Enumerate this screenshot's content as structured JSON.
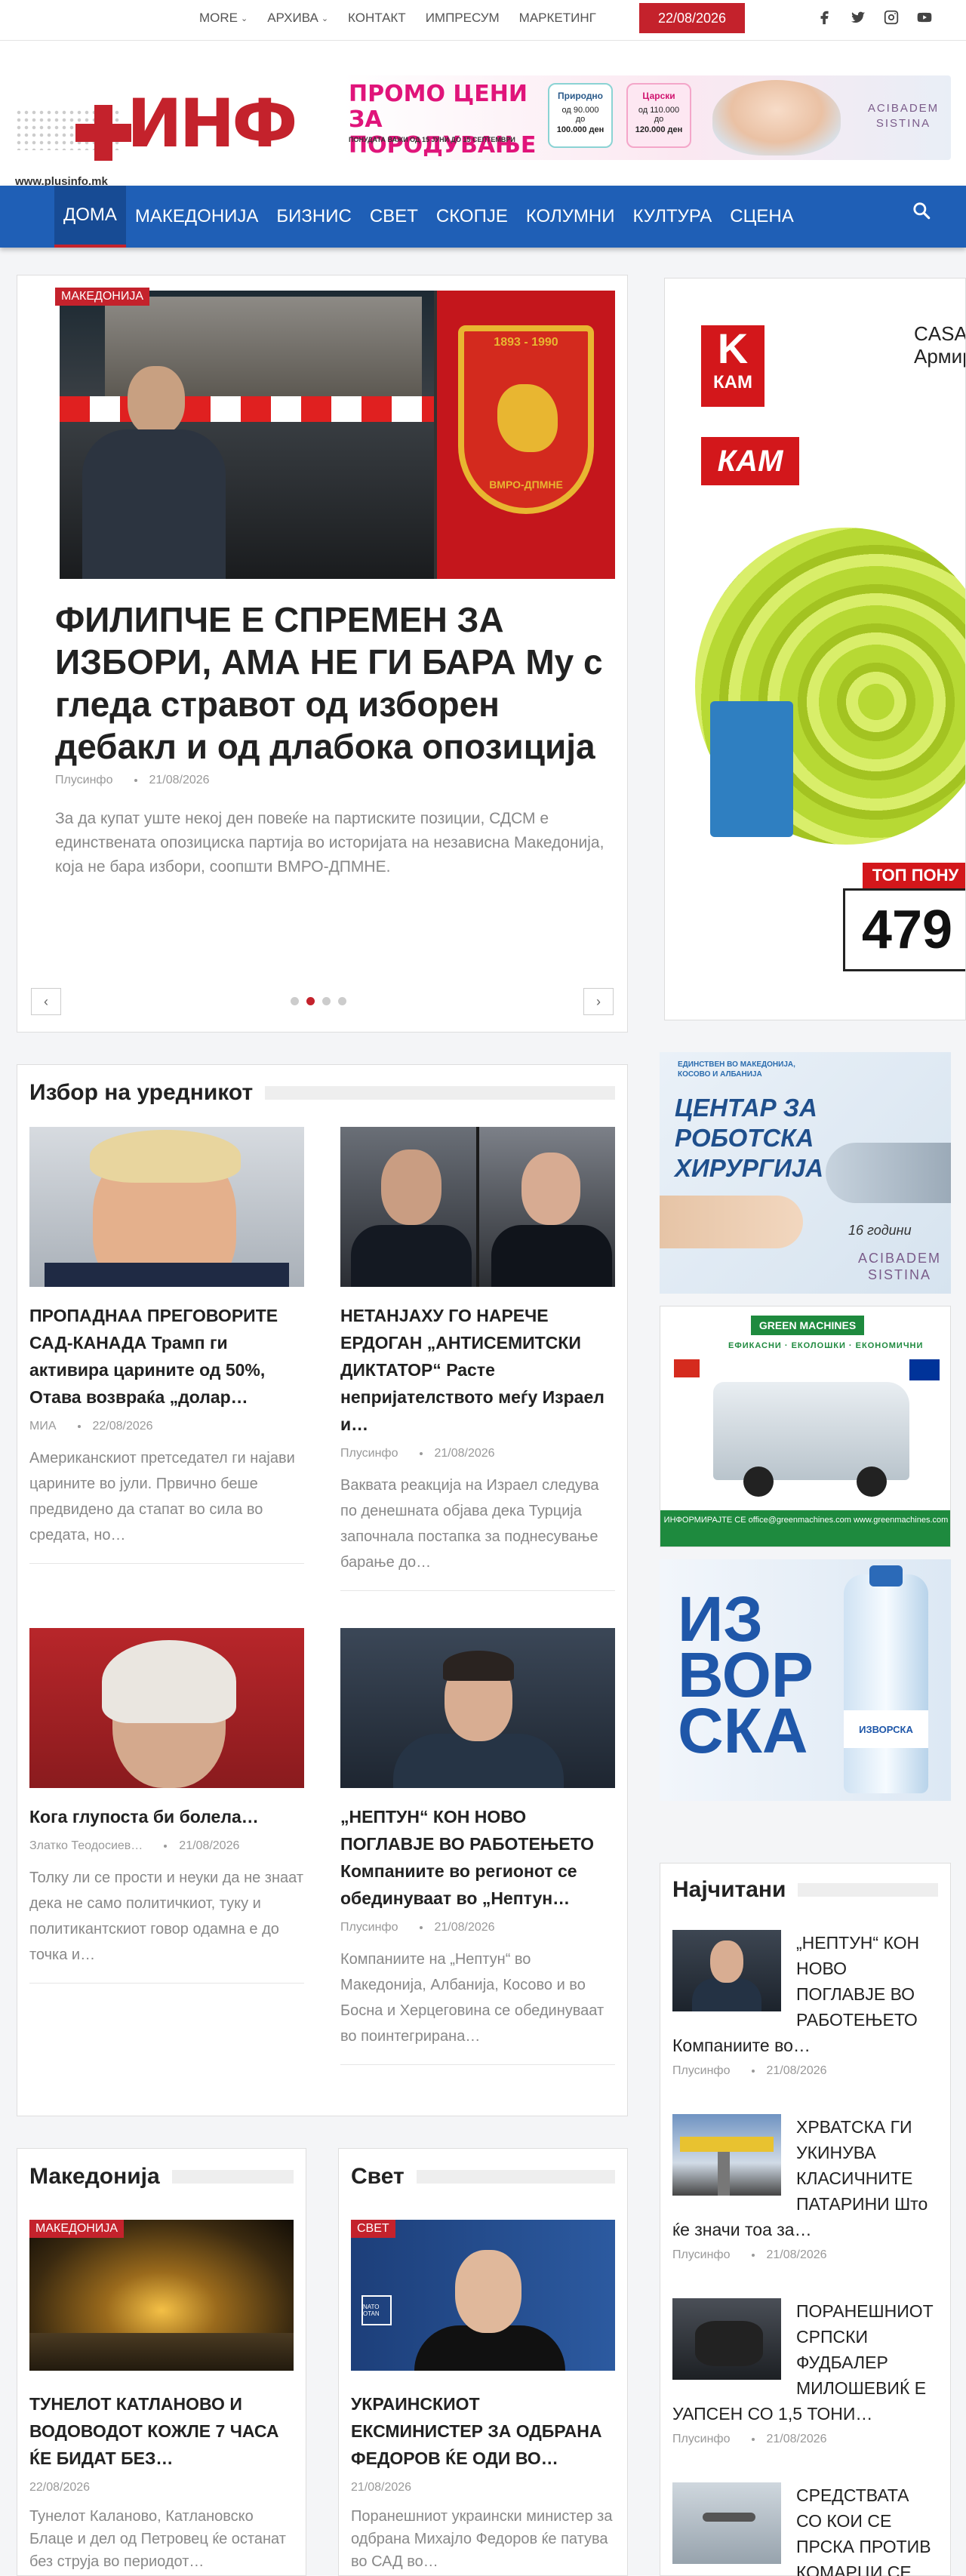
{
  "topbar": {
    "nav": [
      "MORE",
      "АРХИВА",
      "КОНТАКТ",
      "ИМПРЕСУМ",
      "МАРКЕТИНГ"
    ],
    "date": "22/08/2026",
    "socials": [
      "facebook-icon",
      "twitter-icon",
      "instagram-icon",
      "youtube-icon"
    ]
  },
  "header": {
    "logo_text": "ИНФ",
    "logo_url": "www.plusinfo.mk",
    "promo": {
      "title": "ПРОМО ЦЕНИ ЗА ПОРОДУВАЊЕ",
      "note": "ПОНУДАТА ВАЖИ ОД 15 ЈУНИ ДО 15 СЕПТЕМВРИ",
      "card1_title": "Природно",
      "card1_from": "од 90.000",
      "card1_to": "до",
      "card1_price": "100.000 ден",
      "card2_title": "Царски",
      "card2_from": "од 110.000",
      "card2_to": "до",
      "card2_price": "120.000 ден",
      "brand": "ACIBADEM SISTINA"
    }
  },
  "mainnav": {
    "items": [
      "ДОМА",
      "МАКЕДОНИЈА",
      "БИЗНИС",
      "СВЕТ",
      "СКОПЈЕ",
      "КОЛУМНИ",
      "КУЛТУРА",
      "СЦЕНА"
    ],
    "active_index": 0
  },
  "featured": {
    "category": "МАКЕДОНИЈА",
    "title_caps": "ФИЛИПЧЕ Е СПРЕМЕН ЗА ИЗБОРИ, АМА НЕ ГИ БАРА",
    "title_rest": "Му с гледа стравот од изборен дебакл и од длабока опозиција",
    "author": "Плусинфо",
    "date": "21/08/2026",
    "excerpt": "За да купат уште некој ден повеќе на партиските позиции, СДСМ е единствената опозициска партија во историјата на независна Македонија, која не бара избори, соопшти ВМРО-ДПМНЕ.",
    "shield_top": "1893 - 1990",
    "shield_bottom": "ВМРО-ДПМНЕ",
    "prev": "‹",
    "next": "›",
    "slides": 4,
    "active_slide": 1
  },
  "ads": {
    "kam": {
      "logo_letter": "K",
      "logo_word": "КАМ",
      "logo2": "КАМ",
      "brand": "CASA Армир",
      "price_label": "ТОП ПОНУ",
      "price": "479"
    },
    "acibadem": {
      "small": "ЕДИНСТВЕН ВО МАКЕДОНИЈА, КОСОВО И АЛБАНИЈА",
      "title": "ЦЕНТАР ЗА РОБОТСКА ХИРУРГИЈА",
      "years": "16 години",
      "brand": "ACIBADEM SISTINA"
    },
    "green": {
      "logo": "GREEN MACHINES",
      "tags": "ЕФИКАСНИ · ЕКОЛОШКИ · ЕКОНОМИЧНИ",
      "info": "ИНФОРМИРАЈТЕ СЕ office@greenmachines.com www.greenmachines.com"
    },
    "izvorska": {
      "text": "ИЗ ВОР СКА",
      "label": "ИЗВОРСКА"
    }
  },
  "editor": {
    "title": "Избор на уредникот",
    "articles": [
      {
        "title": "ПРОПАДНАА ПРЕГОВОРИТЕ САД-КАНАДА Трамп ги активира царините од 50%, Отава возвраќа „долар…",
        "author": "МИА",
        "date": "22/08/2026",
        "excerpt": "Американскиот претседател ги најави царините во јули. Првично беше предвидено да стапат во сила во средата, но…"
      },
      {
        "title": "НЕТАНЈАХУ ГО НАРЕЧЕ ЕРДОГАН „АНТИСЕМИТСКИ ДИКТАТОР“ Расте непријателството меѓу Израел и…",
        "author": "Плусинфо",
        "date": "21/08/2026",
        "excerpt": "Ваквата реакција на Израел следува по денешната објава дека Турција започнала постапка за поднесување барање до…"
      },
      {
        "title": "Кога глупоста би болела…",
        "author": "Златко Теодосиев…",
        "date": "21/08/2026",
        "excerpt": "Толку ли се прости и неуки да не знаат дека не само политичкиот, туку и политикантскиот говор одамна е до точка и…"
      },
      {
        "title": "„НЕПТУН“ КОН НОВО ПОГЛАВЈЕ ВО РАБОТЕЊЕТО Компаниите во регионот се обединуваат во „Нептун…",
        "author": "Плусинфо",
        "date": "21/08/2026",
        "excerpt": "Компаниите на „Нептун“ во Македонија, Албанија, Косово и во Босна и Херцеговина се обединуваат во поинтегрирана…"
      }
    ]
  },
  "makedonija": {
    "title": "Македонија",
    "category": "МАКЕДОНИЈА",
    "article_title": "ТУНЕЛОТ КАТЛАНОВО И ВОДОВОДОТ КОЖЛЕ 7 ЧАСА ЌЕ БИДАТ БЕЗ…",
    "date": "22/08/2026",
    "excerpt": "Тунелот Каланово, Катлановско Блаце и дел од Петровец ќе останат без струја во периодот…"
  },
  "svet": {
    "title": "Свет",
    "category": "СВЕТ",
    "nato": "NATO OTAN",
    "article_title": "УКРАИНСКИОТ ЕКСМИНИСТЕР ЗА ОДБРАНА ФЕДОРОВ ЌЕ ОДИ ВО…",
    "date": "21/08/2026",
    "excerpt": "Поранешниот украински министер за одбрана Михајло Федоров ќе патува во САД во…"
  },
  "najcitani": {
    "title": "Најчитани",
    "items": [
      {
        "title": "„НЕПТУН“ КОН НОВО ПОГЛАВЈЕ ВО РАБОТЕЊЕТО Компаниите во…",
        "author": "Плусинфо",
        "date": "21/08/2026"
      },
      {
        "title": "ХРВАТСКА ГИ УКИНУВА КЛАСИЧНИТЕ ПАТАРИНИ Што ќе значи тоа за…",
        "author": "Плусинфо",
        "date": "21/08/2026"
      },
      {
        "title": "ПОРАНЕШНИОТ СРПСКИ ФУДБАЛЕР МИЛОШЕВИЌ Е УАПСЕН СО 1,5 ТОНИ…",
        "author": "Плусинфо",
        "date": "21/08/2026"
      },
      {
        "title": "СРЕДСТВАТА СО КОИ СЕ ПРСКА ПРОТИВ КОМАРЦИ СЕ…",
        "author": "",
        "date": ""
      }
    ]
  },
  "colors": {
    "brand_red": "#c4222c",
    "nav_blue": "#1f5fb6"
  }
}
